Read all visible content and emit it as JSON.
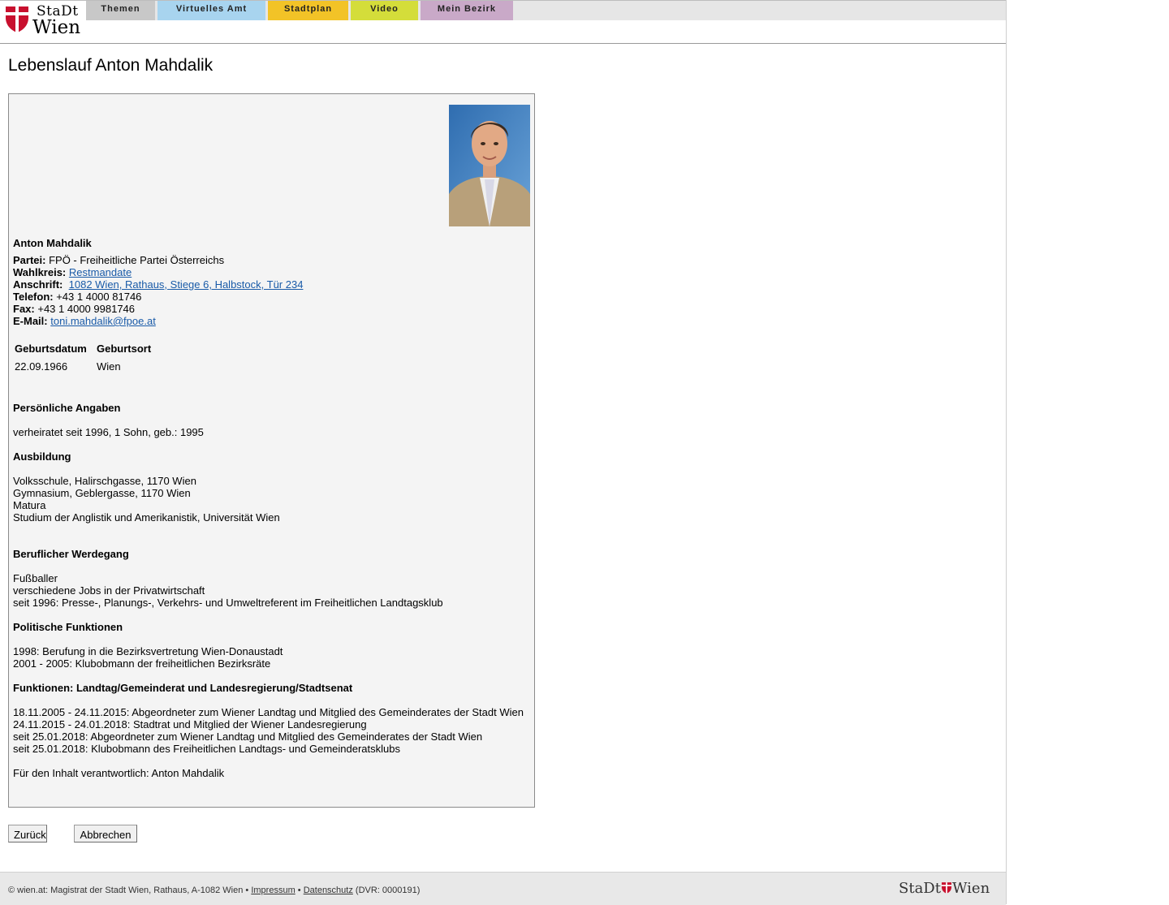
{
  "nav": {
    "tabs": [
      {
        "label": "Themen",
        "color": "#c8c8c8"
      },
      {
        "label": "Virtuelles Amt",
        "color": "#a8d4ef"
      },
      {
        "label": "Stadtplan",
        "color": "#f2c327"
      },
      {
        "label": "Video",
        "color": "#d4dd3a"
      },
      {
        "label": "Mein Bezirk",
        "color": "#c9a9c8"
      }
    ]
  },
  "logo": {
    "stadt": "StaDt",
    "wien": "Wien",
    "shield_color": "#c8102e"
  },
  "page": {
    "title": "Lebenslauf Anton Mahdalik"
  },
  "person": {
    "name": "Anton Mahdalik",
    "partei_label": "Partei:",
    "partei": "FPÖ - Freiheitliche Partei Österreichs",
    "wahlkreis_label": "Wahlkreis:",
    "wahlkreis": "Restmandate",
    "anschrift_label": "Anschrift:",
    "anschrift": "1082 Wien, Rathaus, Stiege 6, Halbstock, Tür 234",
    "telefon_label": "Telefon:",
    "telefon": "+43 1 4000 81746",
    "fax_label": "Fax:",
    "fax": "+43 1 4000 9981746",
    "email_label": "E-Mail:",
    "email": "toni.mahdalik@fpoe.at"
  },
  "info_table": {
    "headers": [
      "Geburtsdatum",
      "Geburtsort"
    ],
    "values": [
      "22.09.1966",
      "Wien"
    ]
  },
  "sections": {
    "persoenlich": {
      "title": "Persönliche Angaben",
      "lines": [
        "verheiratet seit 1996, 1 Sohn, geb.: 1995"
      ]
    },
    "ausbildung": {
      "title": "Ausbildung",
      "lines": [
        "Volksschule, Halirschgasse, 1170 Wien",
        "Gymnasium, Geblergasse, 1170 Wien",
        "Matura",
        "Studium der Anglistik und Amerikanistik, Universität Wien"
      ]
    },
    "beruf": {
      "title": "Beruflicher Werdegang",
      "lines": [
        "Fußballer",
        "verschiedene Jobs in der Privatwirtschaft",
        "seit 1996: Presse-, Planungs-, Verkehrs- und Umweltreferent im Freiheitlichen Landtagsklub"
      ]
    },
    "politik": {
      "title": "Politische Funktionen",
      "lines": [
        "1998: Berufung in die Bezirksvertretung Wien-Donaustadt",
        "2001 - 2005: Klubobmann der freiheitlichen Bezirksräte"
      ]
    },
    "funktionen": {
      "title": "Funktionen: Landtag/Gemeinderat und Landesregierung/Stadtsenat",
      "lines": [
        "18.11.2005 - 24.11.2015: Abgeordneter zum Wiener Landtag und Mitglied des Gemeinderates der Stadt Wien",
        "24.11.2015 - 24.01.2018: Stadtrat und Mitglied der Wiener Landesregierung",
        "seit 25.01.2018: Abgeordneter zum Wiener Landtag und Mitglied des Gemeinderates der Stadt Wien",
        "seit 25.01.2018: Klubobmann des Freiheitlichen Landtags- und Gemeinderatsklubs"
      ]
    },
    "verantwortlich": "Für den Inhalt verantwortlich: Anton Mahdalik"
  },
  "buttons": {
    "back": "Zurück",
    "cancel": "Abbrechen"
  },
  "footer": {
    "copyright": "© wien.at: Magistrat der Stadt Wien, Rathaus, A-1082 Wien • ",
    "impressum": "Impressum",
    "sep": " • ",
    "datenschutz": "Datenschutz",
    "dvr": " (DVR: 0000191)",
    "logo_left": "StaDt",
    "logo_right": "Wien"
  }
}
